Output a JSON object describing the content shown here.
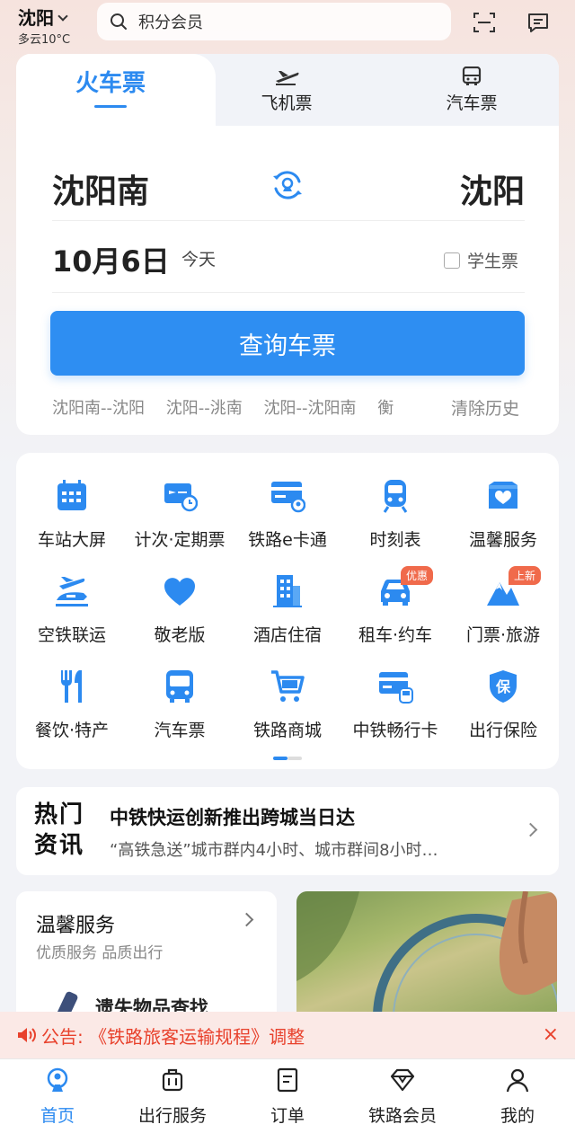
{
  "header": {
    "city": "沈阳",
    "weather": "多云10°C",
    "search_placeholder": "积分会员"
  },
  "booking": {
    "tabs": [
      {
        "label": "火车票",
        "active": true
      },
      {
        "label": "飞机票",
        "icon": "plane-icon"
      },
      {
        "label": "汽车票",
        "icon": "bus-icon"
      }
    ],
    "from_station": "沈阳南",
    "to_station": "沈阳",
    "date": "10月6日",
    "day_label": "今天",
    "student_ticket_label": "学生票",
    "student_ticket_checked": false,
    "query_button": "查询车票",
    "history": [
      "沈阳南--沈阳",
      "沈阳--洮南",
      "沈阳--沈阳南",
      "衡"
    ],
    "clear_history": "清除历史"
  },
  "services": [
    {
      "label": "车站大屏",
      "icon": "calendar-grid-icon"
    },
    {
      "label": "计次·定期票",
      "icon": "ticket-clock-icon"
    },
    {
      "label": "铁路e卡通",
      "icon": "card-icon"
    },
    {
      "label": "时刻表",
      "icon": "train-icon"
    },
    {
      "label": "温馨服务",
      "icon": "heart-box-icon"
    },
    {
      "label": "空铁联运",
      "icon": "plane-train-icon"
    },
    {
      "label": "敬老版",
      "icon": "heart-icon"
    },
    {
      "label": "酒店住宿",
      "icon": "hotel-icon"
    },
    {
      "label": "租车·约车",
      "icon": "car-icon",
      "badge": "优惠"
    },
    {
      "label": "门票·旅游",
      "icon": "mountain-icon",
      "badge": "上新"
    },
    {
      "label": "餐饮·特产",
      "icon": "fork-knife-icon"
    },
    {
      "label": "汽车票",
      "icon": "bus-icon"
    },
    {
      "label": "铁路商城",
      "icon": "cart-icon"
    },
    {
      "label": "中铁畅行卡",
      "icon": "card-train-icon"
    },
    {
      "label": "出行保险",
      "icon": "shield-icon",
      "icon_text": "保"
    }
  ],
  "news": {
    "tag_line1": "热门",
    "tag_line2": "资讯",
    "title": "中铁快运创新推出跨城当日达",
    "subtitle": "“高铁急送”城市群内4小时、城市群间8小时…"
  },
  "warm_service": {
    "title": "温馨服务",
    "subtitle": "优质服务 品质出行",
    "item": "遗失物品查找"
  },
  "announcement": {
    "text": "公告: 《铁路旅客运输规程》调整",
    "close": "×"
  },
  "bottom_nav": [
    {
      "label": "首页",
      "active": true
    },
    {
      "label": "出行服务"
    },
    {
      "label": "订单"
    },
    {
      "label": "铁路会员"
    },
    {
      "label": "我的"
    }
  ],
  "colors": {
    "accent": "#2c8af0",
    "alert": "#e8412c"
  }
}
